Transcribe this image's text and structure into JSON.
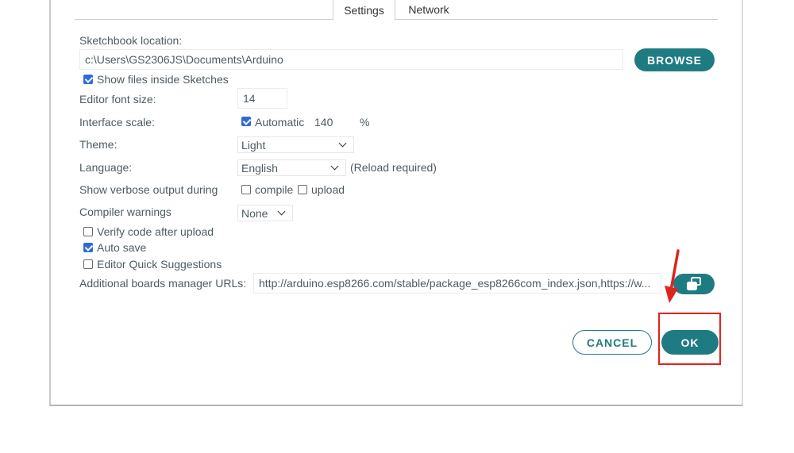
{
  "tabs": [
    {
      "label": "Settings",
      "active": true
    },
    {
      "label": "Network",
      "active": false
    }
  ],
  "sketchbook": {
    "label": "Sketchbook location:",
    "value": "c:\\Users\\GS2306JS\\Documents\\Arduino",
    "browse_label": "BROWSE"
  },
  "show_files": {
    "label": "Show files inside Sketches",
    "checked": true
  },
  "font_size": {
    "label": "Editor font size:",
    "value": "14"
  },
  "interface_scale": {
    "label": "Interface scale:",
    "automatic_label": "Automatic",
    "automatic_checked": true,
    "value": "140",
    "unit": "%"
  },
  "theme": {
    "label": "Theme:",
    "value": "Light"
  },
  "language": {
    "label": "Language:",
    "value": "English",
    "note": "(Reload required)"
  },
  "verbose": {
    "label": "Show verbose output during",
    "compile_label": "compile",
    "compile_checked": false,
    "upload_label": "upload",
    "upload_checked": false
  },
  "compiler_warnings": {
    "label": "Compiler warnings",
    "value": "None"
  },
  "verify": {
    "label": "Verify code after upload",
    "checked": false
  },
  "autosave": {
    "label": "Auto save",
    "checked": true
  },
  "quick_suggestions": {
    "label": "Editor Quick Suggestions",
    "checked": false
  },
  "boards_urls": {
    "label": "Additional boards manager URLs:",
    "value": "http://arduino.esp8266.com/stable/package_esp8266com_index.json,https://w..."
  },
  "buttons": {
    "cancel_label": "CANCEL",
    "ok_label": "OK"
  },
  "colors": {
    "accent": "#1f7b82",
    "checkbox": "#2e6bd6",
    "highlight": "#e0231c"
  },
  "icons": {
    "boards_button": "open-window-icon",
    "annotation": "red-arrow-icon"
  }
}
